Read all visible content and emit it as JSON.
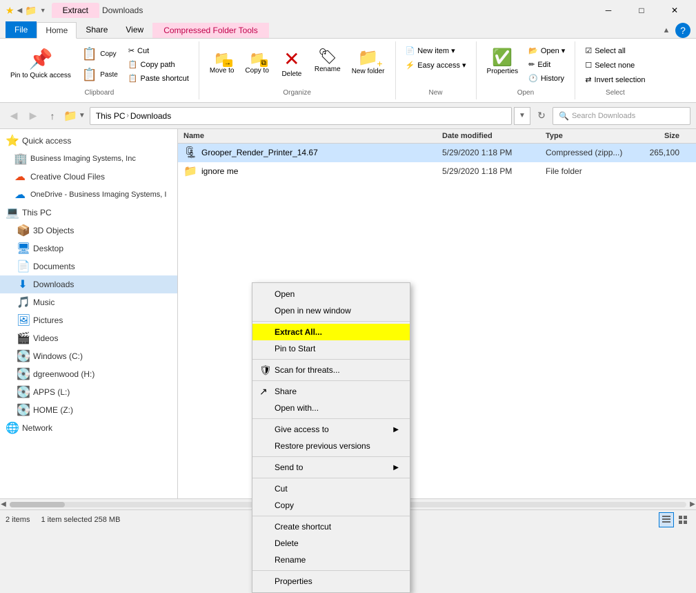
{
  "titlebar": {
    "title": "Downloads",
    "extract_tab": "Extract",
    "min_label": "─",
    "max_label": "□",
    "close_label": "✕"
  },
  "ribbon_tabs": {
    "file": "File",
    "home": "Home",
    "share": "Share",
    "view": "View",
    "compressed": "Compressed Folder Tools"
  },
  "clipboard": {
    "pin_label": "Pin to Quick\naccess",
    "copy_label": "Copy",
    "paste_label": "Paste",
    "cut_label": "Cut",
    "copy_path_label": "Copy path",
    "paste_shortcut_label": "Paste shortcut",
    "group_label": "Clipboard"
  },
  "organize": {
    "move_to_label": "Move\nto",
    "copy_to_label": "Copy\nto",
    "delete_label": "Delete",
    "rename_label": "Rename",
    "new_folder_label": "New\nfolder",
    "group_label": "Organize"
  },
  "new_group": {
    "new_item_label": "New item ▾",
    "easy_access_label": "Easy access ▾",
    "group_label": "New"
  },
  "open_group": {
    "properties_label": "Properties",
    "open_label": "Open ▾",
    "edit_label": "Edit",
    "history_label": "History",
    "group_label": "Open"
  },
  "select_group": {
    "select_all_label": "Select all",
    "select_none_label": "Select none",
    "invert_label": "Invert selection",
    "group_label": "Select"
  },
  "address": {
    "path_this_pc": "This PC",
    "path_downloads": "Downloads",
    "search_placeholder": "Search Downloads"
  },
  "sidebar": {
    "quick_access": "Quick access",
    "business_imaging": "Business Imaging Systems, Inc",
    "creative_cloud": "Creative Cloud Files",
    "onedrive": "OneDrive - Business Imaging Systems, I",
    "this_pc": "This PC",
    "objects_3d": "3D Objects",
    "desktop": "Desktop",
    "documents": "Documents",
    "downloads": "Downloads",
    "music": "Music",
    "pictures": "Pictures",
    "videos": "Videos",
    "windows_c": "Windows (C:)",
    "dgreenwood_h": "dgreenwood (H:)",
    "apps_l": "APPS (L:)",
    "home_z": "HOME (Z:)",
    "network": "Network"
  },
  "file_list": {
    "headers": {
      "name": "Name",
      "date_modified": "Date modified",
      "type": "Type",
      "size": "Size"
    },
    "files": [
      {
        "name": "Grooper_Render_Printer_14.67",
        "date": "5/29/2020 1:18 PM",
        "type": "Compressed (zipp...)",
        "size": "265,100",
        "icon": "🗜",
        "selected": true
      },
      {
        "name": "ignore me",
        "date": "5/29/2020 1:18 PM",
        "type": "File folder",
        "size": "",
        "icon": "📁",
        "selected": false
      }
    ]
  },
  "context_menu": {
    "items": [
      {
        "label": "Open",
        "icon": "",
        "has_arrow": false,
        "separator_after": false,
        "highlighted": false
      },
      {
        "label": "Open in new window",
        "icon": "",
        "has_arrow": false,
        "separator_after": true,
        "highlighted": false
      },
      {
        "label": "Extract All...",
        "icon": "",
        "has_arrow": false,
        "separator_after": false,
        "highlighted": true
      },
      {
        "label": "Pin to Start",
        "icon": "",
        "has_arrow": false,
        "separator_after": true,
        "highlighted": false
      },
      {
        "label": "Scan for threats...",
        "icon": "🛡",
        "has_arrow": false,
        "separator_after": true,
        "highlighted": false
      },
      {
        "label": "Share",
        "icon": "↗",
        "has_arrow": false,
        "separator_after": false,
        "highlighted": false
      },
      {
        "label": "Open with...",
        "icon": "",
        "has_arrow": false,
        "separator_after": true,
        "highlighted": false
      },
      {
        "label": "Give access to",
        "icon": "",
        "has_arrow": true,
        "separator_after": false,
        "highlighted": false
      },
      {
        "label": "Restore previous versions",
        "icon": "",
        "has_arrow": false,
        "separator_after": true,
        "highlighted": false
      },
      {
        "label": "Send to",
        "icon": "",
        "has_arrow": true,
        "separator_after": true,
        "highlighted": false
      },
      {
        "label": "Cut",
        "icon": "",
        "has_arrow": false,
        "separator_after": false,
        "highlighted": false
      },
      {
        "label": "Copy",
        "icon": "",
        "has_arrow": false,
        "separator_after": true,
        "highlighted": false
      },
      {
        "label": "Create shortcut",
        "icon": "",
        "has_arrow": false,
        "separator_after": false,
        "highlighted": false
      },
      {
        "label": "Delete",
        "icon": "",
        "has_arrow": false,
        "separator_after": false,
        "highlighted": false
      },
      {
        "label": "Rename",
        "icon": "",
        "has_arrow": false,
        "separator_after": true,
        "highlighted": false
      },
      {
        "label": "Properties",
        "icon": "",
        "has_arrow": false,
        "separator_after": false,
        "highlighted": false
      }
    ]
  },
  "statusbar": {
    "items_count": "2 items",
    "selection": "1 item selected  258 MB"
  }
}
